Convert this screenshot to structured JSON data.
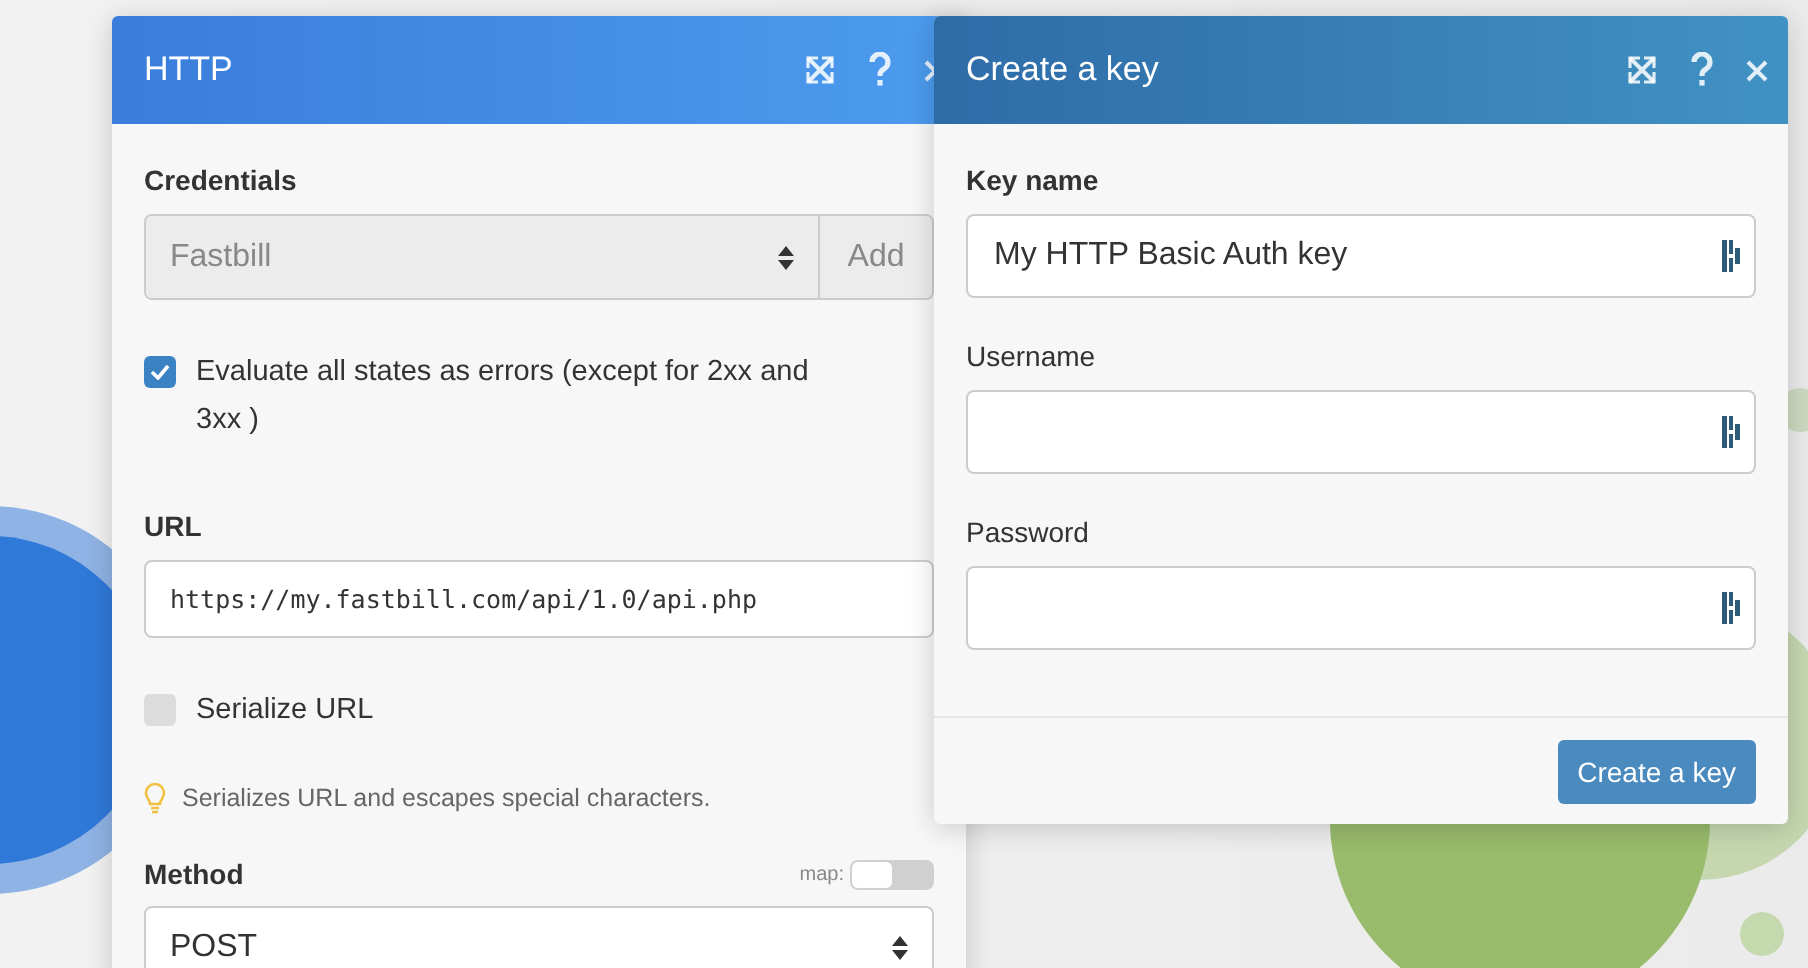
{
  "http_panel": {
    "title": "HTTP",
    "credentials": {
      "label": "Credentials",
      "value": "Fastbill",
      "disabled": true,
      "add_button": "Add"
    },
    "evaluate_errors": {
      "label": "Evaluate all states as errors (except for 2xx and 3xx )",
      "checked": true
    },
    "url": {
      "label": "URL",
      "value": "https://my.fastbill.com/api/1.0/api.php"
    },
    "serialize_url": {
      "label": "Serialize URL",
      "checked": false
    },
    "hint": "Serializes URL and escapes special characters.",
    "method": {
      "label": "Method",
      "map_label": "map:",
      "map_on": false,
      "value": "POST"
    }
  },
  "key_dialog": {
    "title": "Create a key",
    "fields": [
      {
        "label": "Key name",
        "required": true,
        "value": "My HTTP Basic Auth key"
      },
      {
        "label": "Username",
        "required": false
      },
      {
        "label": "Password",
        "required": false
      }
    ],
    "submit_button": "Create a key"
  }
}
